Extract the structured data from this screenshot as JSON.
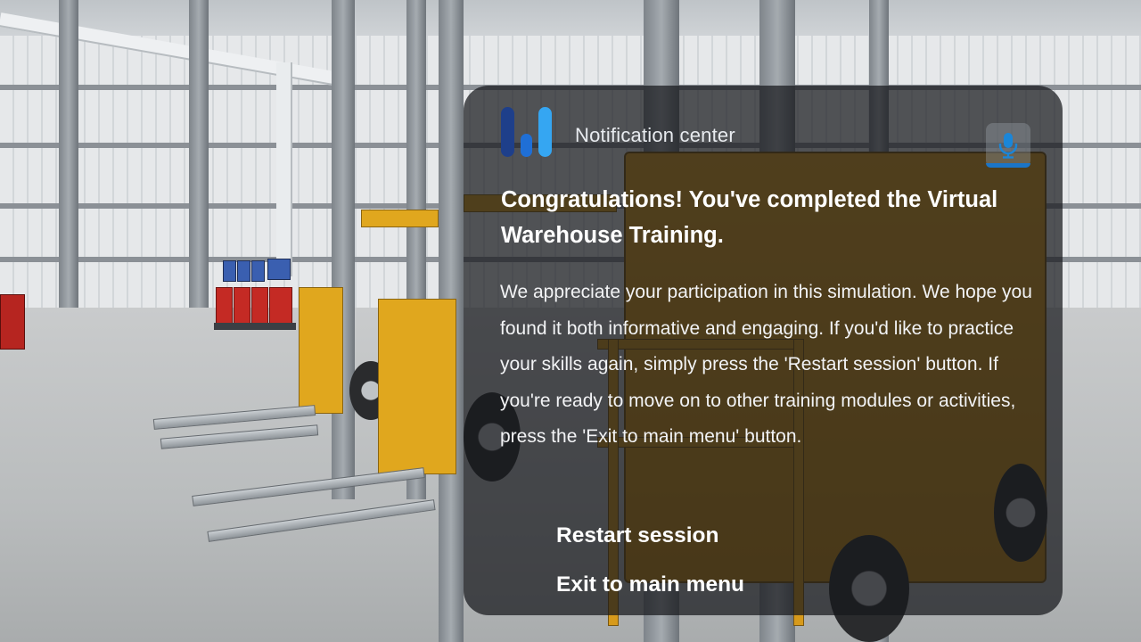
{
  "notification": {
    "header_title": "Notification center",
    "logo_icon": "app-logo-bars",
    "mic_icon": "microphone-icon",
    "headline": "Congratulations! You've completed the Virtual Warehouse Training.",
    "body": "We appreciate your participation in this simulation. We hope you found it both informative and engaging.  If you'd like to practice your skills again, simply press the 'Restart session' button. If you're ready to move on to other training modules or activities, press the 'Exit to main menu' button.",
    "actions": {
      "restart_label": "Restart session",
      "exit_label": "Exit to main menu"
    }
  },
  "colors": {
    "panel_bg": "#16181c",
    "accent": "#1b75c7",
    "logo_dark": "#1e3f8a",
    "logo_mid": "#1f6fd6",
    "logo_light": "#35a6f2",
    "forklift_yellow": "#e0a71e"
  }
}
